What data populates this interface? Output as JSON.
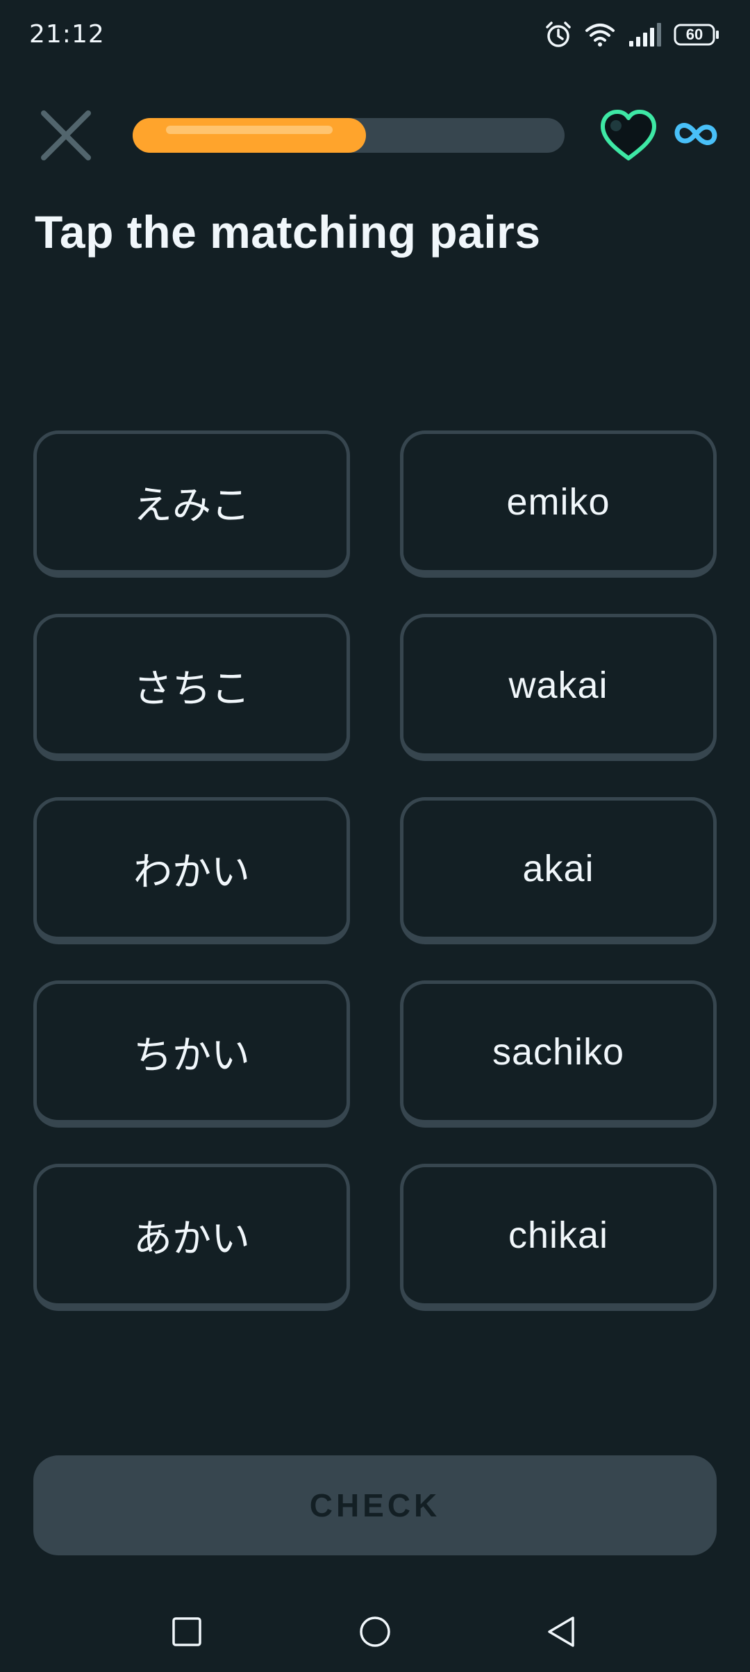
{
  "status_bar": {
    "time": "21:12",
    "battery": "60",
    "icons": [
      "alarm-icon",
      "wifi-icon",
      "signal-icon",
      "battery-icon"
    ]
  },
  "top_bar": {
    "close_icon": "close-icon",
    "progress_fraction": 0.54,
    "hearts_icon": "heart-icon",
    "hearts_value_icon": "infinity-icon"
  },
  "title": "Tap the matching pairs",
  "pairs": {
    "left": [
      "えみこ",
      "さちこ",
      "わかい",
      "ちかい",
      "あかい"
    ],
    "right": [
      "emiko",
      "wakai",
      "akai",
      "sachiko",
      "chikai"
    ]
  },
  "check_button": {
    "label": "CHECK"
  },
  "nav_bar": {
    "icons": [
      "recents-icon",
      "home-icon",
      "back-icon"
    ]
  },
  "colors": {
    "background": "#131f24",
    "tile_border": "#37464f",
    "progress_fill": "#ffa42c",
    "heart_outline": "#3ee8a5",
    "infinity": "#49c0f8",
    "text": "#f1f7fb"
  }
}
